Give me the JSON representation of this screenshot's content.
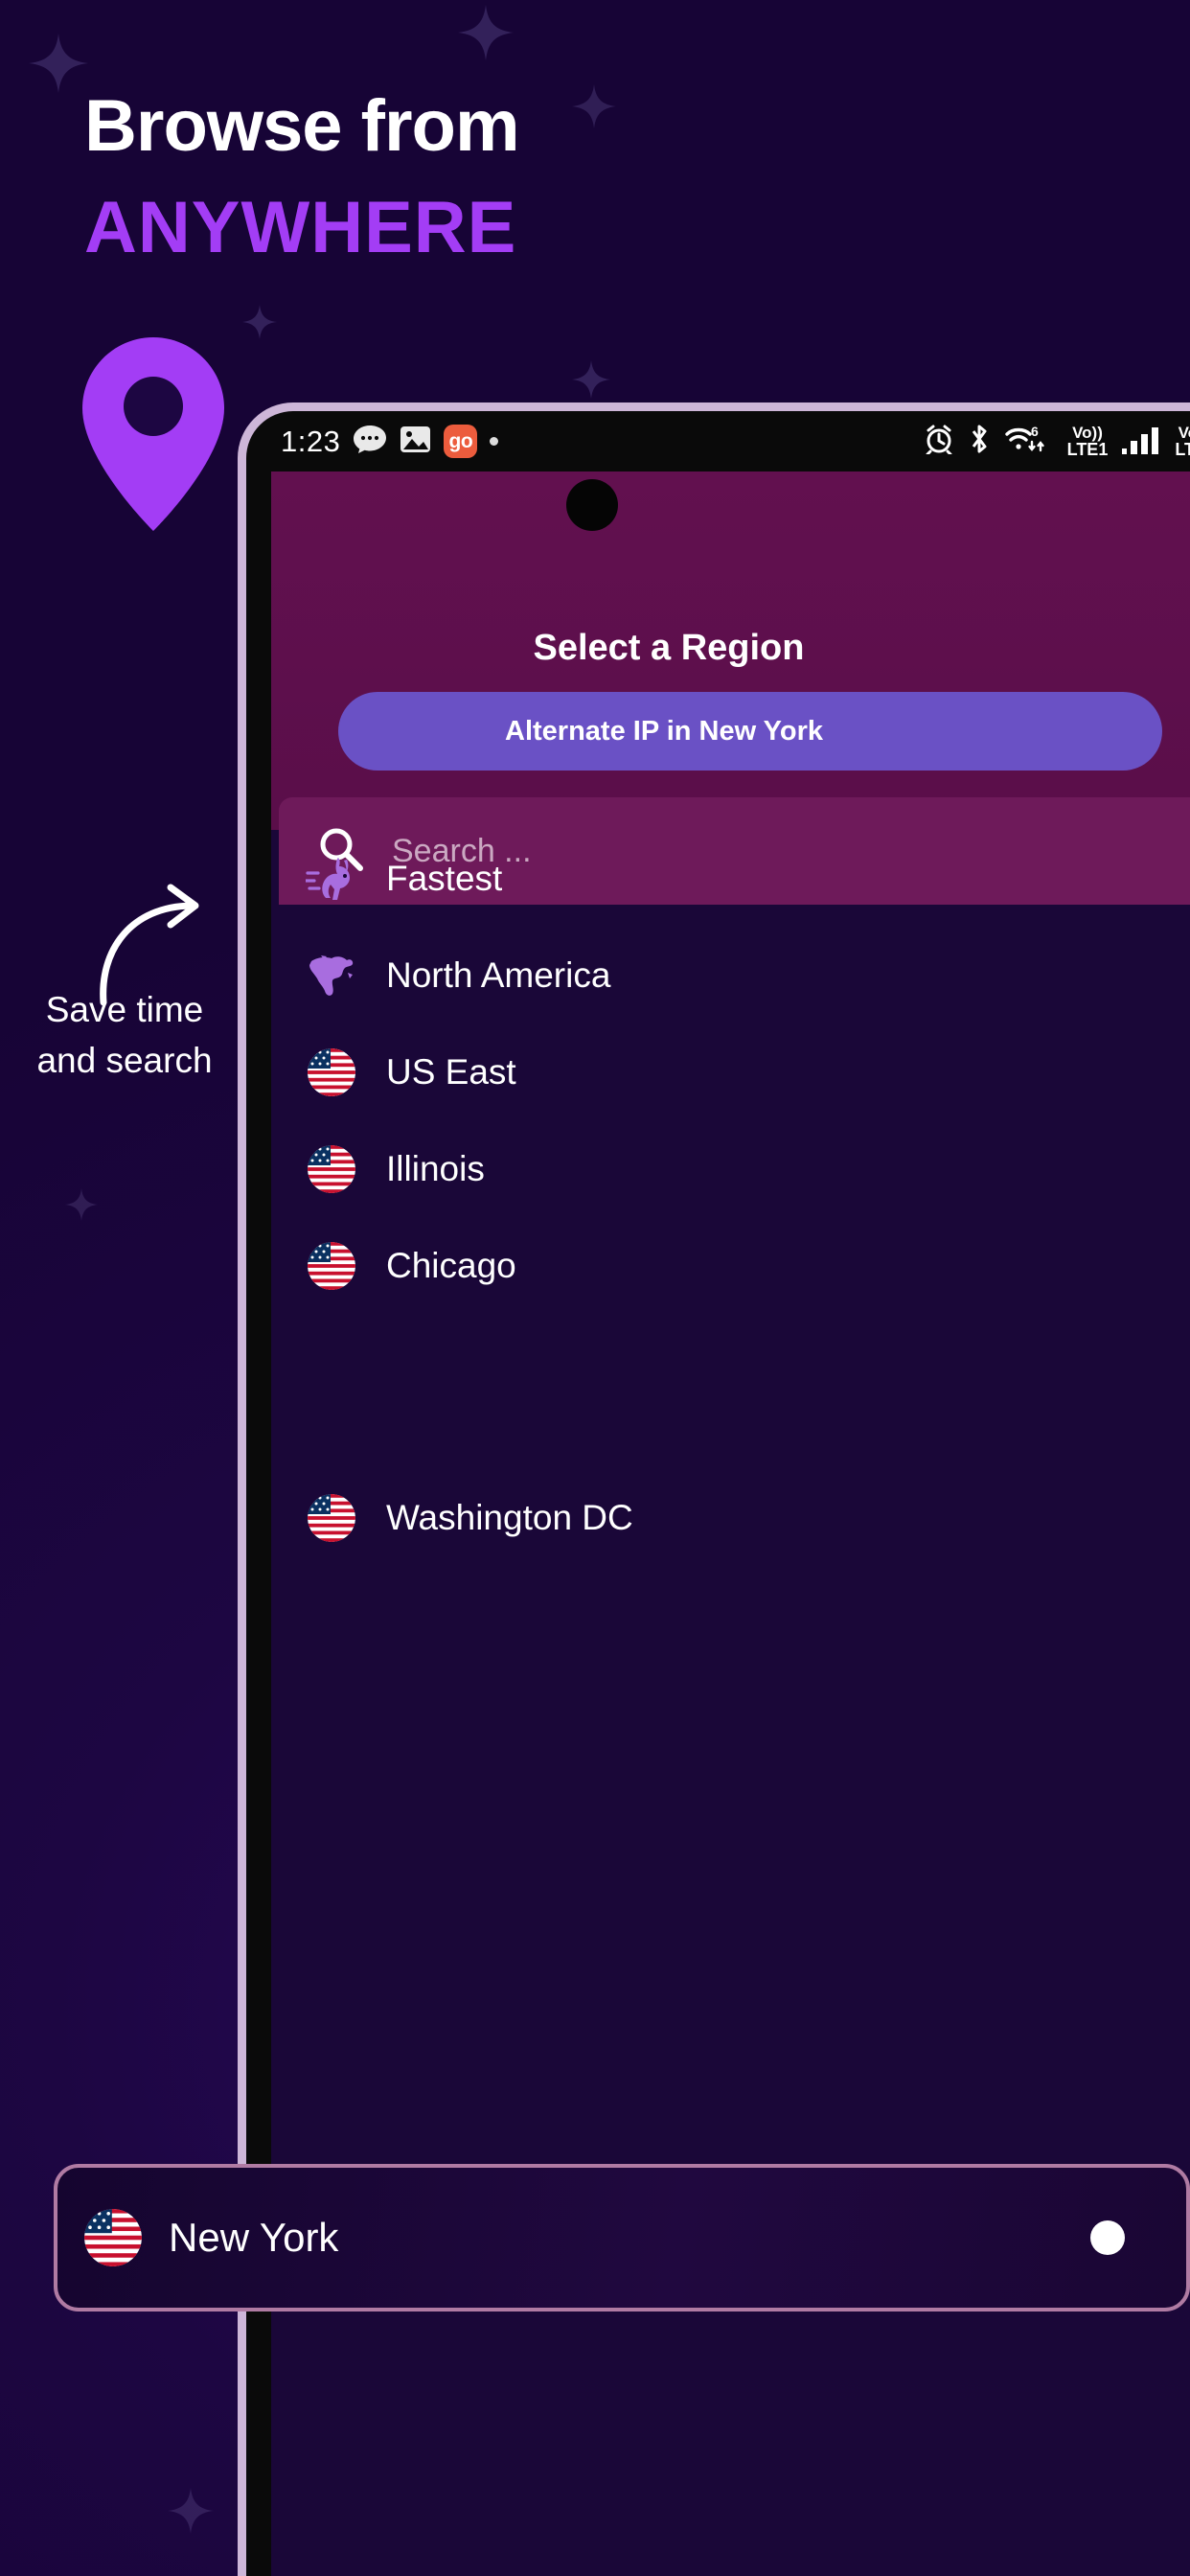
{
  "promo": {
    "headline_line1": "Browse from",
    "headline_line2": "ANYWHERE",
    "annotation_line1": "Save time",
    "annotation_line2": "and search",
    "accent_color": "#a33df5",
    "background_color": "#1d0642",
    "pin_icon": "location-pin-icon",
    "arrow_icon": "curved-arrow-icon"
  },
  "phone": {
    "statusbar": {
      "time": "1:23",
      "left_icons": [
        "messages-icon",
        "photos-icon",
        "go-app-icon",
        "dot-indicator"
      ],
      "go_badge_label": "go",
      "right_icons": [
        "alarm-icon",
        "bluetooth-icon",
        "wifi-6-icon",
        "signal-bars-icon"
      ],
      "volte_primary": "Vo))",
      "volte_primary_sub": "LTE1",
      "volte_secondary": "Vo)",
      "volte_secondary_sub": "LTE"
    },
    "header": {
      "title": "Select a Region",
      "alternate_ip_label": "Alternate IP in New York",
      "header_color": "#62104f",
      "button_color": "#6a51c5"
    },
    "search": {
      "placeholder": "Search ...",
      "icon": "search-icon"
    },
    "regions": [
      {
        "label": "Fastest",
        "icon": "rabbit-icon"
      },
      {
        "label": "North America",
        "icon": "north-america-map-icon"
      },
      {
        "label": "US East",
        "icon": "us-flag-icon"
      },
      {
        "label": "Illinois",
        "icon": "us-flag-icon"
      },
      {
        "label": "Chicago",
        "icon": "us-flag-icon"
      },
      {
        "label": "Washington DC",
        "icon": "us-flag-icon"
      }
    ],
    "selected_region": {
      "label": "New York",
      "icon": "us-flag-icon",
      "selected": true,
      "highlight_border_color": "#b07ba3"
    }
  }
}
